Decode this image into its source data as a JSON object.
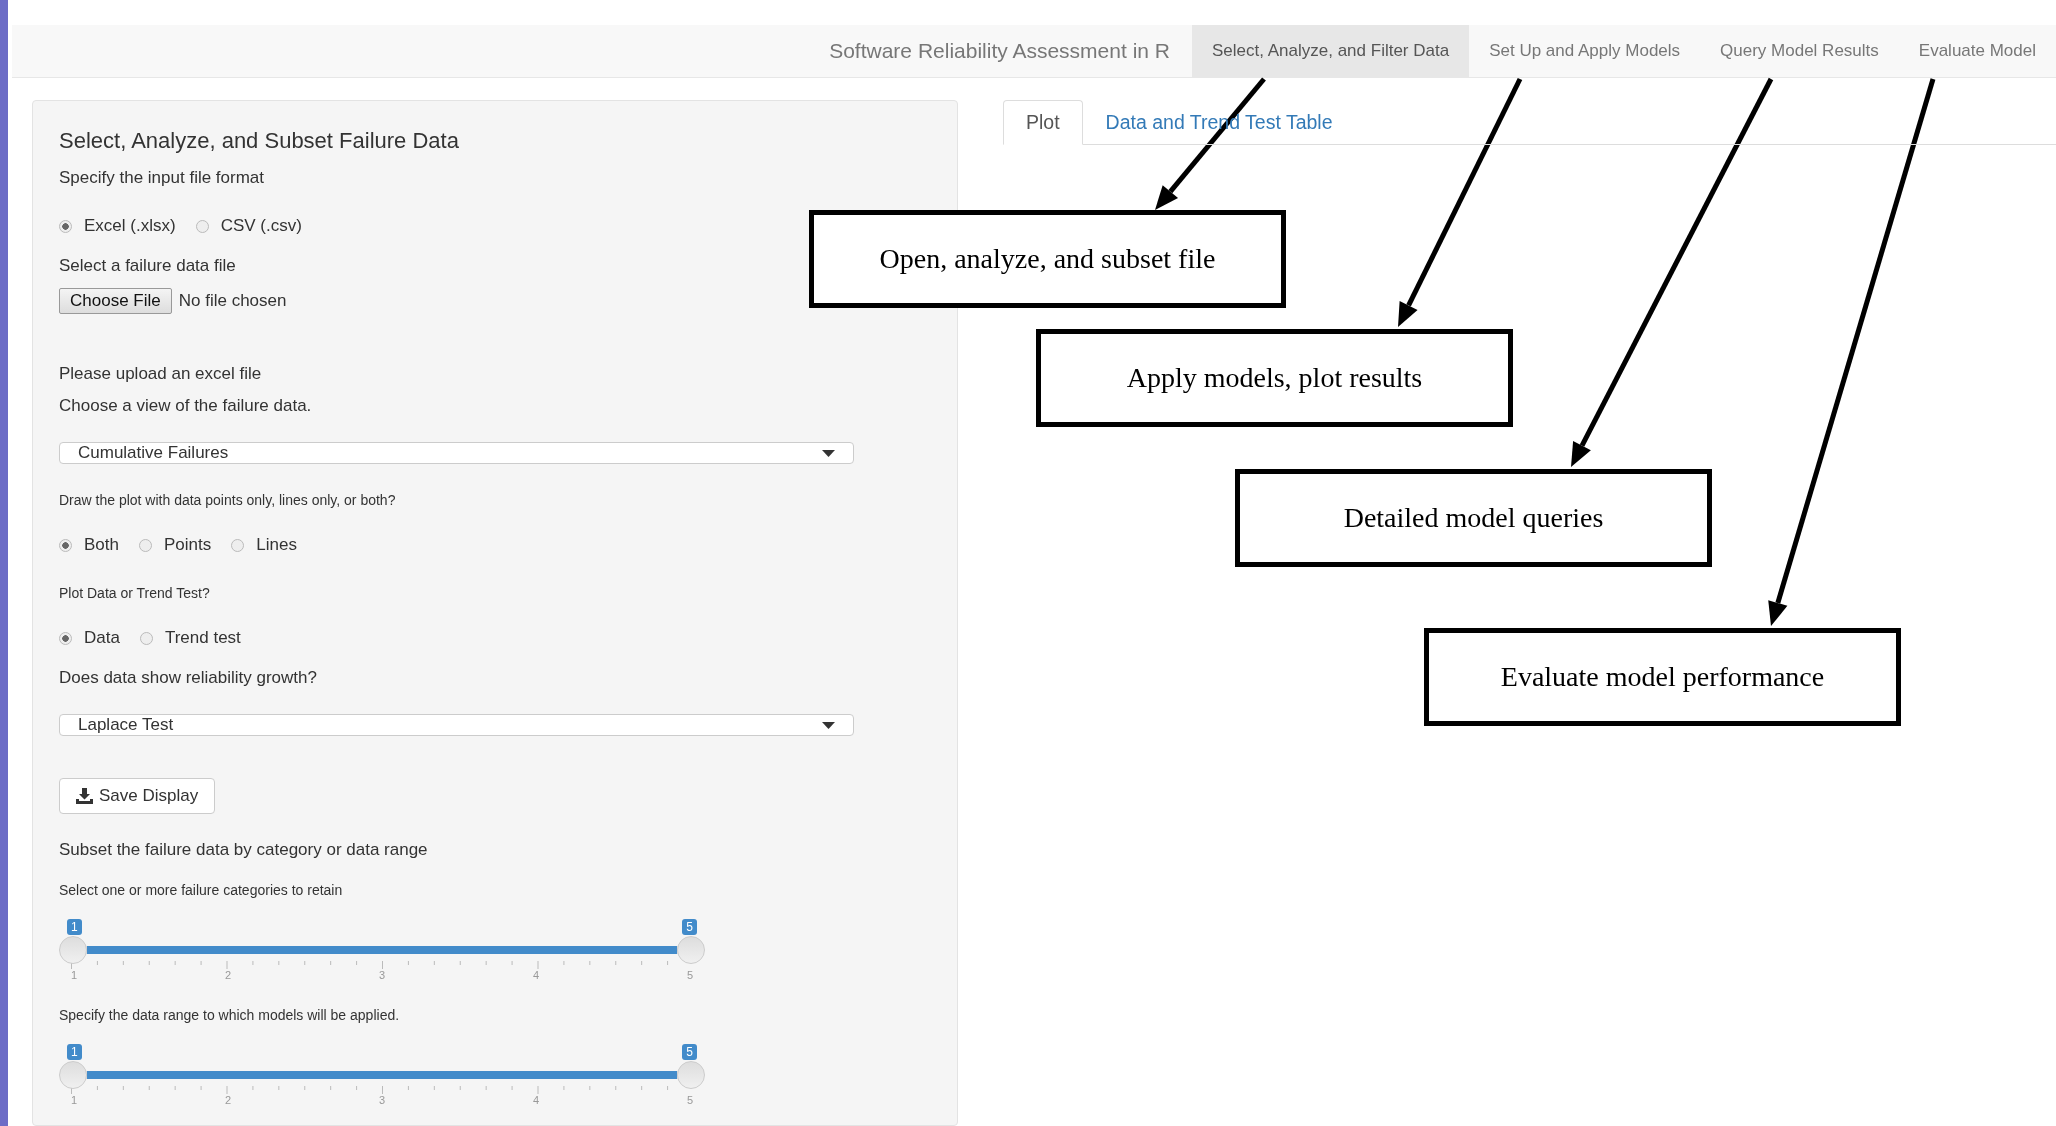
{
  "navbar": {
    "brand": "Software Reliability Assessment in R",
    "tabs": [
      {
        "label": "Select, Analyze, and Filter Data",
        "selected": true
      },
      {
        "label": "Set Up and Apply Models",
        "selected": false
      },
      {
        "label": "Query Model Results",
        "selected": false
      },
      {
        "label": "Evaluate Model",
        "selected": false
      }
    ]
  },
  "sidebar": {
    "title": "Select, Analyze, and Subset Failure Data",
    "items": [
      {
        "kind": "label",
        "text": "Specify the input file format"
      },
      {
        "kind": "radio",
        "options": [
          {
            "label": "Excel (.xlsx)",
            "selected": true
          },
          {
            "label": "CSV (.csv)",
            "selected": false
          }
        ]
      },
      {
        "kind": "label",
        "text": "Select a failure data file"
      },
      {
        "kind": "file",
        "button": "Choose File",
        "status": "No file chosen"
      },
      {
        "kind": "label",
        "text": "Please upload an excel file"
      },
      {
        "kind": "label",
        "text": "Choose a view of the failure data."
      },
      {
        "kind": "select",
        "value": "Cumulative Failures"
      },
      {
        "kind": "hint",
        "text": "Draw the plot with data points only, lines only, or both?"
      },
      {
        "kind": "radio",
        "options": [
          {
            "label": "Both",
            "selected": true
          },
          {
            "label": "Points",
            "selected": false
          },
          {
            "label": "Lines",
            "selected": false
          }
        ]
      },
      {
        "kind": "hint",
        "text": "Plot Data or Trend Test?"
      },
      {
        "kind": "radio",
        "options": [
          {
            "label": "Data",
            "selected": true
          },
          {
            "label": "Trend test",
            "selected": false
          }
        ]
      },
      {
        "kind": "label",
        "text": "Does data show reliability growth?"
      },
      {
        "kind": "select",
        "value": "Laplace Test"
      },
      {
        "kind": "button",
        "label": "Save Display"
      },
      {
        "kind": "label",
        "text": "Subset the failure data by category or data range"
      },
      {
        "kind": "hint",
        "text": "Select one or more failure categories to retain"
      },
      {
        "kind": "slider",
        "from": "1",
        "to": "5",
        "level": 1,
        "ticks": [
          "1",
          "2",
          "3",
          "4",
          "5"
        ]
      },
      {
        "kind": "hint",
        "text": "Specify the data range to which models will be applied."
      },
      {
        "kind": "slider",
        "from": "1",
        "to": "5",
        "level": 1,
        "ticks": [
          "1",
          "2",
          "3",
          "4",
          "5"
        ]
      }
    ]
  },
  "main_tabs": [
    {
      "label": "Plot",
      "selected": true
    },
    {
      "label": "Data and Trend Test Table",
      "selected": false
    }
  ],
  "callouts": [
    {
      "text": "Open, analyze, and subset file"
    },
    {
      "text": "Apply models, plot results"
    },
    {
      "text": "Detailed model queries"
    },
    {
      "text": "Evaluate model performance"
    }
  ]
}
